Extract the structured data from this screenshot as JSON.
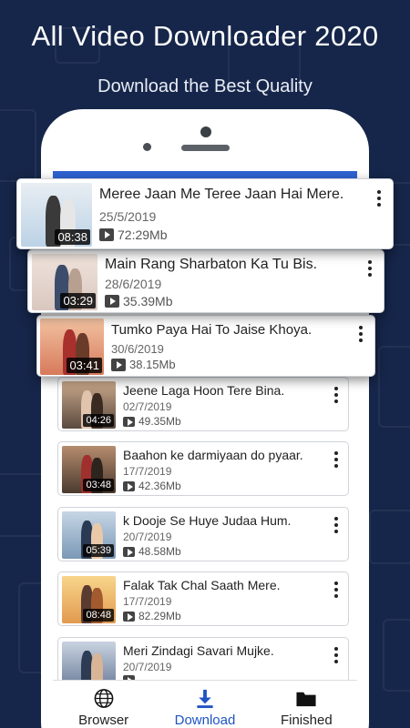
{
  "promo": {
    "headline": "All Video Downloader 2020",
    "subline": "Download the Best Quality"
  },
  "videos": [
    {
      "title": "Meree Jaan Me Teree Jaan Hai  Mere.",
      "date": "25/5/2019",
      "size": "72:29Mb",
      "duration": "08:38"
    },
    {
      "title": "Main Rang Sharbaton Ka Tu Bis.",
      "date": "28/6/2019",
      "size": "35.39Mb",
      "duration": "03:29"
    },
    {
      "title": "Tumko Paya Hai To Jaise Khoya.",
      "date": "30/6/2019",
      "size": "38.15Mb",
      "duration": "03:41"
    },
    {
      "title": "Jeene Laga Hoon Tere Bina.",
      "date": "02/7/2019",
      "size": "49.35Mb",
      "duration": "04:26"
    },
    {
      "title": "Baahon ke darmiyaan do pyaar.",
      "date": "17/7/2019",
      "size": "42.36Mb",
      "duration": "03:48"
    },
    {
      "title": "k Dooje Se Huye Judaa  Hum.",
      "date": "20/7/2019",
      "size": "48.58Mb",
      "duration": "05:39"
    },
    {
      "title": "Falak Tak Chal Saath Mere.",
      "date": "17/7/2019",
      "size": "82.29Mb",
      "duration": "08:48"
    },
    {
      "title": "Meri Zindagi Savari Mujke.",
      "date": "20/7/2019",
      "size": "",
      "duration": ""
    }
  ],
  "nav": [
    {
      "label": "Browser",
      "icon": "globe-icon"
    },
    {
      "label": "Download",
      "icon": "download-icon"
    },
    {
      "label": "Finished",
      "icon": "folder-icon"
    }
  ],
  "colors": {
    "background": "#16264a",
    "accent": "#1f54c4"
  }
}
